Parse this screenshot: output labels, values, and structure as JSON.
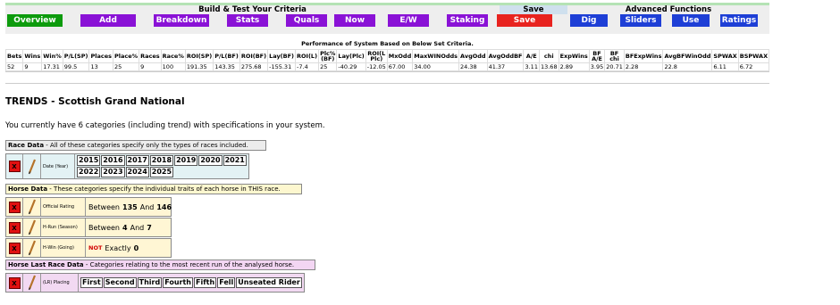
{
  "toolbar": {
    "groups": {
      "build": "Build & Test Your Criteria",
      "save": "Save",
      "advanced": "Advanced Functions"
    },
    "buttons": [
      {
        "label": "Overview",
        "color": "green"
      },
      {
        "label": "Add",
        "color": "purple"
      },
      {
        "label": "Breakdown",
        "color": "purple"
      },
      {
        "label": "Stats",
        "color": "purple"
      },
      {
        "label": "Quals",
        "color": "purple"
      },
      {
        "label": "Now",
        "color": "purple"
      },
      {
        "label": "E/W",
        "color": "purple"
      },
      {
        "label": "Staking",
        "color": "purple"
      },
      {
        "label": "Save",
        "color": "red"
      },
      {
        "label": "Dig",
        "color": "blue"
      },
      {
        "label": "Sliders",
        "color": "blue"
      },
      {
        "label": "Use",
        "color": "blue"
      },
      {
        "label": "Ratings",
        "color": "blue"
      }
    ]
  },
  "performance": {
    "title": "Performance of System Based on Below Set Criteria.",
    "headers": [
      "Bets",
      "Wins",
      "Win%",
      "P/L(SP)",
      "Places",
      "Place%",
      "Races",
      "Race%",
      "ROI(SP)",
      "P/L(BF)",
      "ROI(BF)",
      "Lay(BF)",
      "ROI(L)",
      "Plc% (BF)",
      "Lay(Plc)",
      "ROI(L Plc)",
      "MxOdd",
      "MaxWINOdds",
      "AvgOdd",
      "AvgOddBF",
      "A/E",
      "chi",
      "ExpWins",
      "BF A/E",
      "BF chi",
      "BFExpWins",
      "AvgBFWinOdd",
      "SPWAX",
      "BSPWAX"
    ],
    "values": [
      "52",
      "9",
      "17.31",
      "99.5",
      "13",
      "25",
      "9",
      "100",
      "191.35",
      "143.35",
      "275.68",
      "-155.31",
      "-7.4",
      "25",
      "-40.29",
      "-12.05",
      "67.00",
      "34.00",
      "24.38",
      "41.37",
      "3.11",
      "13.68",
      "2.89",
      "3.95",
      "20.71",
      "2.28",
      "22.8",
      "6.11",
      "6.72"
    ]
  },
  "trends": {
    "title": "TRENDS - Scottish Grand National",
    "intro": "You currently have 6 categories (including trend) with specifications in your system."
  },
  "race_data": {
    "header_bold": "Race Data",
    "header_rest": " - All of these categories specify only the types of races included.",
    "date_label": "Date (Year)",
    "years": [
      "2015",
      "2016",
      "2017",
      "2018",
      "2019",
      "2020",
      "2021",
      "2022",
      "2023",
      "2024",
      "2025"
    ]
  },
  "horse_data": {
    "header_bold": "Horse Data",
    "header_rest": " - These categories specify the individual traits of each horse in THIS race.",
    "rows": [
      {
        "label": "Official Rating",
        "pre": "Between",
        "a": "135",
        "mid": "And",
        "b": "146"
      },
      {
        "label": "H-Run (Season)",
        "pre": "Between",
        "a": "4",
        "mid": "And",
        "b": "7"
      },
      {
        "label": "H-Win (Going)",
        "not": "NOT",
        "pre": "Exactly",
        "a": "0"
      }
    ]
  },
  "last_race": {
    "header_bold": "Horse Last Race Data",
    "header_rest": " - Categories relating to the most recent run of the analysed horse.",
    "placing_label": "(LR) Placing",
    "placings": [
      "First",
      "Second",
      "Third",
      "Fourth",
      "Fifth",
      "Fell",
      "Unseated Rider"
    ]
  },
  "x_label": "X"
}
